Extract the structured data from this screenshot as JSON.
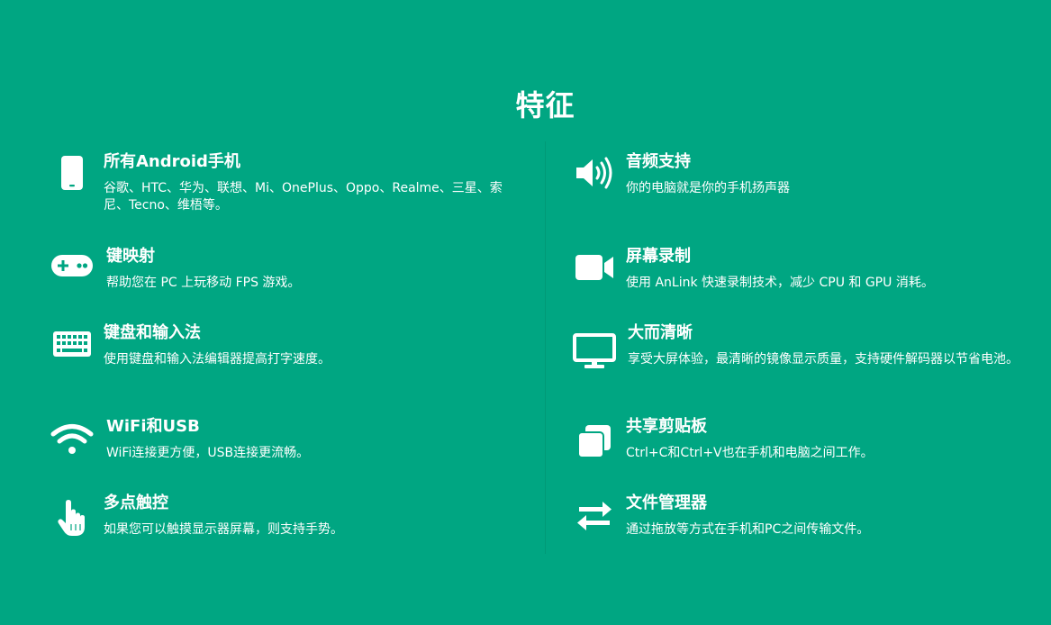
{
  "section": {
    "title": "特征"
  },
  "features_left": [
    {
      "title": "所有Android手机",
      "description": "谷歌、HTC、华为、联想、Mi、OnePlus、Oppo、Realme、三星、索尼、Tecno、维梧等。",
      "icon": "smartphone-icon"
    },
    {
      "title": "键映射",
      "description": "帮助您在 PC 上玩移动 FPS 游戏。",
      "icon": "gamepad-icon"
    },
    {
      "title": "键盘和输入法",
      "description": "使用键盘和输入法编辑器提高打字速度。",
      "icon": "keyboard-icon"
    },
    {
      "title": "WiFi和USB",
      "description": "WiFi连接更方便，USB连接更流畅。",
      "icon": "wifi-icon"
    },
    {
      "title": "多点触控",
      "description": "如果您可以触摸显示器屏幕，则支持手势。",
      "icon": "touch-hand-icon"
    }
  ],
  "features_right": [
    {
      "title": "音频支持",
      "description": "你的电脑就是你的手机扬声器",
      "icon": "speaker-icon"
    },
    {
      "title": "屏幕录制",
      "description": "使用 AnLink 快速录制技术，减少 CPU 和 GPU 消耗。",
      "icon": "video-camera-icon"
    },
    {
      "title": "大而清晰",
      "description": "享受大屏体验，最清晰的镜像显示质量，支持硬件解码器以节省电池。",
      "icon": "monitor-icon"
    },
    {
      "title": "共享剪贴板",
      "description": "Ctrl+C和Ctrl+V也在手机和电脑之间工作。",
      "icon": "clipboard-copy-icon"
    },
    {
      "title": "文件管理器",
      "description": "通过拖放等方式在手机和PC之间传输文件。",
      "icon": "transfer-arrows-icon"
    }
  ],
  "colors": {
    "background": "#00a682",
    "text": "#ffffff"
  }
}
